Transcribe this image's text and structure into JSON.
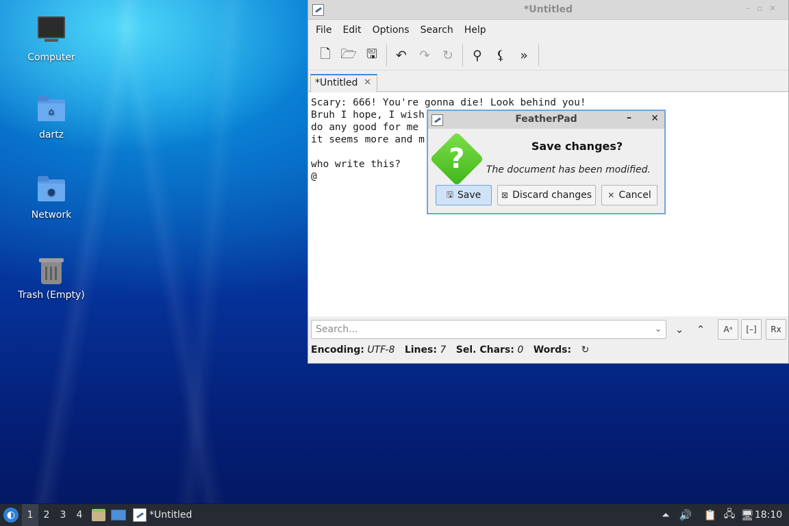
{
  "desktop": {
    "icons": [
      {
        "label": "Computer"
      },
      {
        "label": "dartz"
      },
      {
        "label": "Network"
      },
      {
        "label": "Trash (Empty)"
      }
    ]
  },
  "window": {
    "title": "*Untitled",
    "menu": [
      "File",
      "Edit",
      "Options",
      "Search",
      "Help"
    ],
    "toolbar_icons": [
      "new-document-icon",
      "open-folder-icon",
      "save-icon",
      "undo-icon",
      "redo-icon",
      "reload-icon",
      "find-icon",
      "replace-icon",
      "more-icon"
    ],
    "tab": {
      "label": "*Untitled"
    },
    "editor_text": "Scary: 666! You're gonna die! Look behind you!\nBruh I hope, I wish\ndo any good for me\nit seems more and m\n\nwho write this?\n@",
    "search": {
      "placeholder": "Search..."
    },
    "status": {
      "encoding_label": "Encoding:",
      "encoding_value": "UTF-8",
      "lines_label": "Lines:",
      "lines_value": "7",
      "sel_label": "Sel. Chars:",
      "sel_value": "0",
      "words_label": "Words:"
    }
  },
  "dialog": {
    "title": "FeatherPad",
    "heading": "Save changes?",
    "message": "The document has been modified.",
    "buttons": {
      "save": "Save",
      "discard": "Discard changes",
      "cancel": "Cancel"
    }
  },
  "taskbar": {
    "workspaces": [
      "1",
      "2",
      "3",
      "4"
    ],
    "task_label": "*Untitled",
    "clock": "18:10"
  },
  "colors": {
    "accent": "#3c8ad6",
    "dialog_border": "#6ea6dc",
    "taskbar": "#252a33"
  }
}
